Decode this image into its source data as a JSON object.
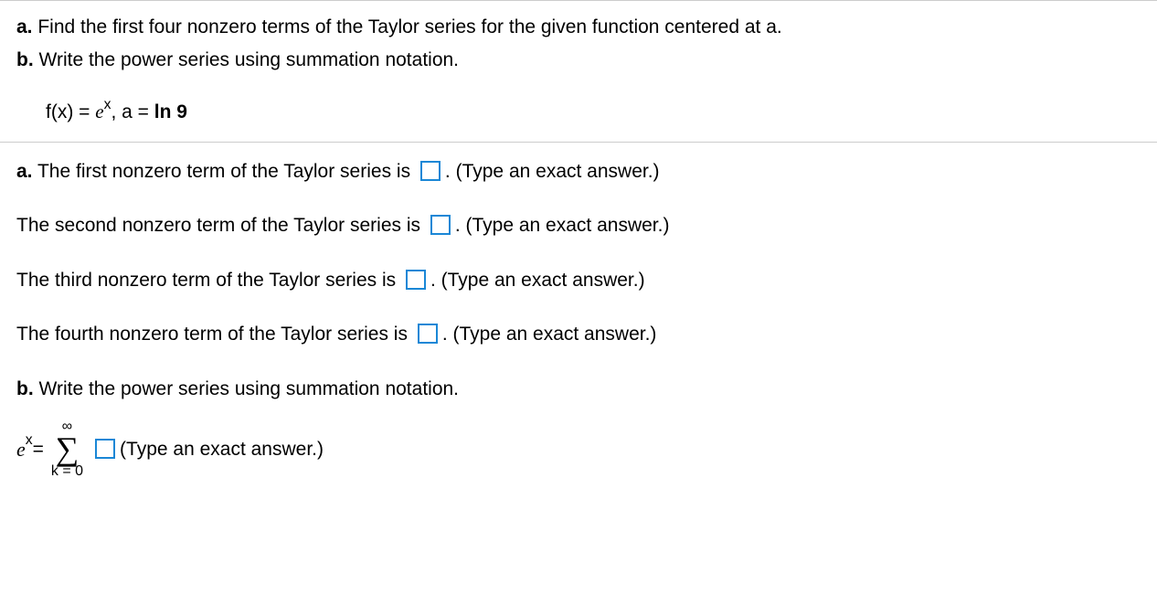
{
  "question": {
    "partA": {
      "label": "a.",
      "text": "Find the first four nonzero terms of the Taylor series for the given function centered at a."
    },
    "partB": {
      "label": "b.",
      "text": "Write the power series using summation notation."
    },
    "equation": {
      "fx": "f(x) = ",
      "e": "e",
      "sup": "x",
      "comma": ", a = ",
      "value": "ln 9"
    }
  },
  "answers": {
    "partA": {
      "label": "a.",
      "prompts": [
        {
          "pre": " The first nonzero term of the Taylor series is ",
          "post": ". (Type an exact answer.)"
        },
        {
          "pre": "The second nonzero term of the Taylor series is ",
          "post": ". (Type an exact answer.)"
        },
        {
          "pre": "The third nonzero term of the Taylor series is ",
          "post": ". (Type an exact answer.)"
        },
        {
          "pre": "The fourth nonzero term of the Taylor series is ",
          "post": ". (Type an exact answer.)"
        }
      ]
    },
    "partB": {
      "label": "b.",
      "text": "Write the power series using summation notation.",
      "sum": {
        "e": "e",
        "sup": "x",
        "equals": " = ",
        "top": "∞",
        "sigma": "∑",
        "bottom": "k = 0",
        "post": "(Type an exact answer.)"
      }
    }
  }
}
